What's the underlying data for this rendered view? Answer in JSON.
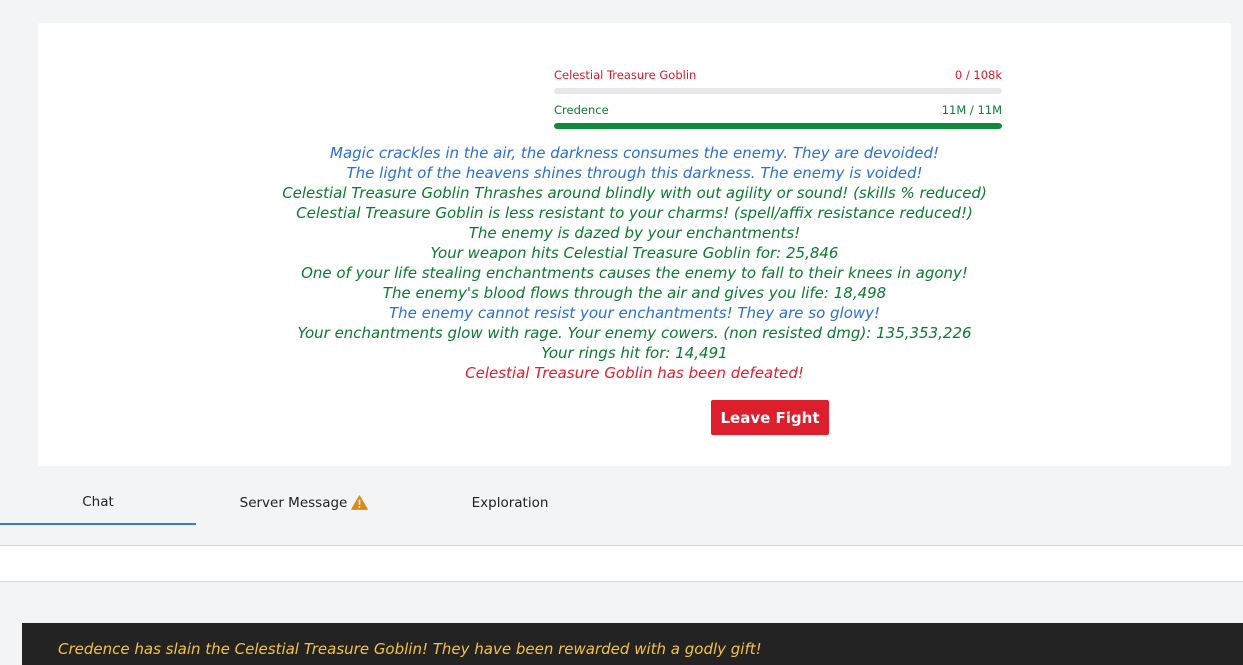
{
  "monster": {
    "name": "Celestial Treasure Goblin",
    "hp_text": "0 / 108k",
    "hp_fraction": 0.0
  },
  "player": {
    "name": "Credence",
    "hp_text": "11M / 11M",
    "hp_fraction": 1.0
  },
  "battle_log": [
    {
      "text": "Magic crackles in the air, the darkness consumes the enemy. They are devoided!",
      "color": "#2a6fdb"
    },
    {
      "text": "The light of the heavens shines through this darkness. The enemy is voided!",
      "color": "#2a6fdb"
    },
    {
      "text": "Celestial Treasure Goblin Thrashes around blindly with out agility or sound! (skills % reduced)",
      "color": "#0c7a2f"
    },
    {
      "text": "Celestial Treasure Goblin is less resistant to your charms! (spell/affix resistance reduced!)",
      "color": "#0c7a2f"
    },
    {
      "text": "The enemy is dazed by your enchantments!",
      "color": "#0c7a2f"
    },
    {
      "text": "Your weapon hits Celestial Treasure Goblin for: 25,846",
      "color": "#0c7a2f"
    },
    {
      "text": "One of your life stealing enchantments causes the enemy to fall to their knees in agony!",
      "color": "#0c7a2f"
    },
    {
      "text": "The enemy's blood flows through the air and gives you life: 18,498",
      "color": "#0c7a2f"
    },
    {
      "text": "The enemy cannot resist your enchantments! They are so glowy!",
      "color": "#2a6fdb"
    },
    {
      "text": "Your enchantments glow with rage. Your enemy cowers. (non resisted dmg): 135,353,226",
      "color": "#0c7a2f"
    },
    {
      "text": "Your rings hit for: 14,491",
      "color": "#0c7a2f"
    },
    {
      "text": "Celestial Treasure Goblin has been defeated!",
      "color": "#e0202f"
    }
  ],
  "leave_button": {
    "label": "Leave Fight"
  },
  "tabs": [
    {
      "label": "Chat",
      "active": true
    },
    {
      "label": "Server Message",
      "icon": "warning-icon"
    },
    {
      "label": "Exploration"
    }
  ],
  "chat": {
    "message": "Credence has slain the Celestial Treasure Goblin! They have been rewarded with a godly gift!",
    "color": "#f5c23c"
  }
}
